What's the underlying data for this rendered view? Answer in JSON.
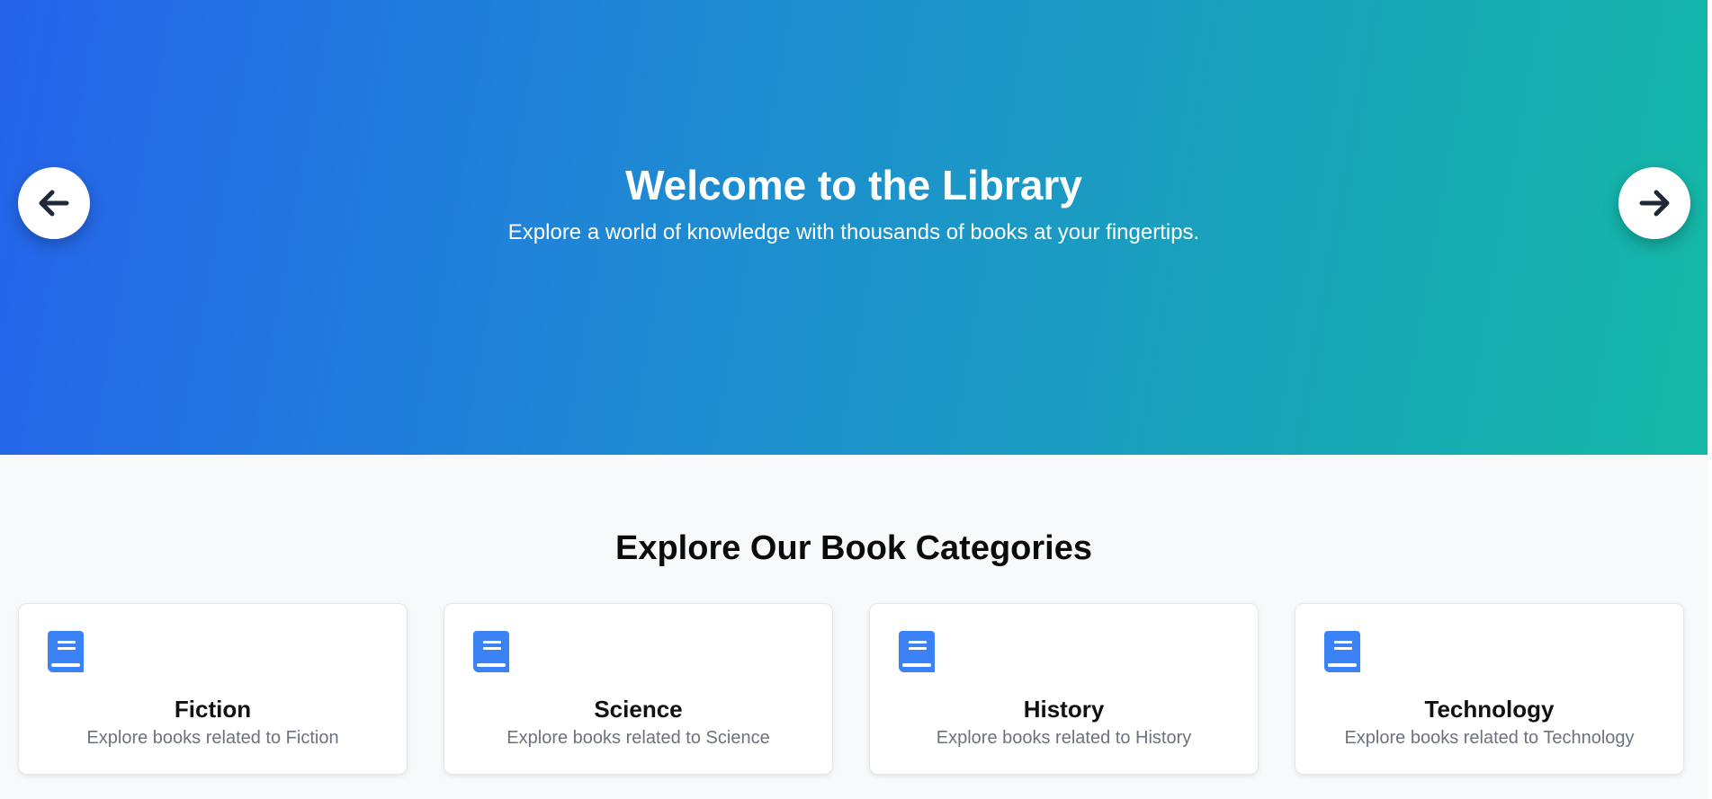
{
  "hero": {
    "title": "Welcome to the Library",
    "subtitle": "Explore a world of knowledge with thousands of books at your fingertips.",
    "gradient_start": "#2563eb",
    "gradient_end": "#14b8a6",
    "prev_icon": "arrow-left-icon",
    "next_icon": "arrow-right-icon"
  },
  "categories": {
    "heading": "Explore Our Book Categories",
    "icon": "book-icon",
    "icon_color": "#3b82f6",
    "items": [
      {
        "title": "Fiction",
        "description": "Explore books related to Fiction"
      },
      {
        "title": "Science",
        "description": "Explore books related to Science"
      },
      {
        "title": "History",
        "description": "Explore books related to History"
      },
      {
        "title": "Technology",
        "description": "Explore books related to Technology"
      }
    ]
  }
}
